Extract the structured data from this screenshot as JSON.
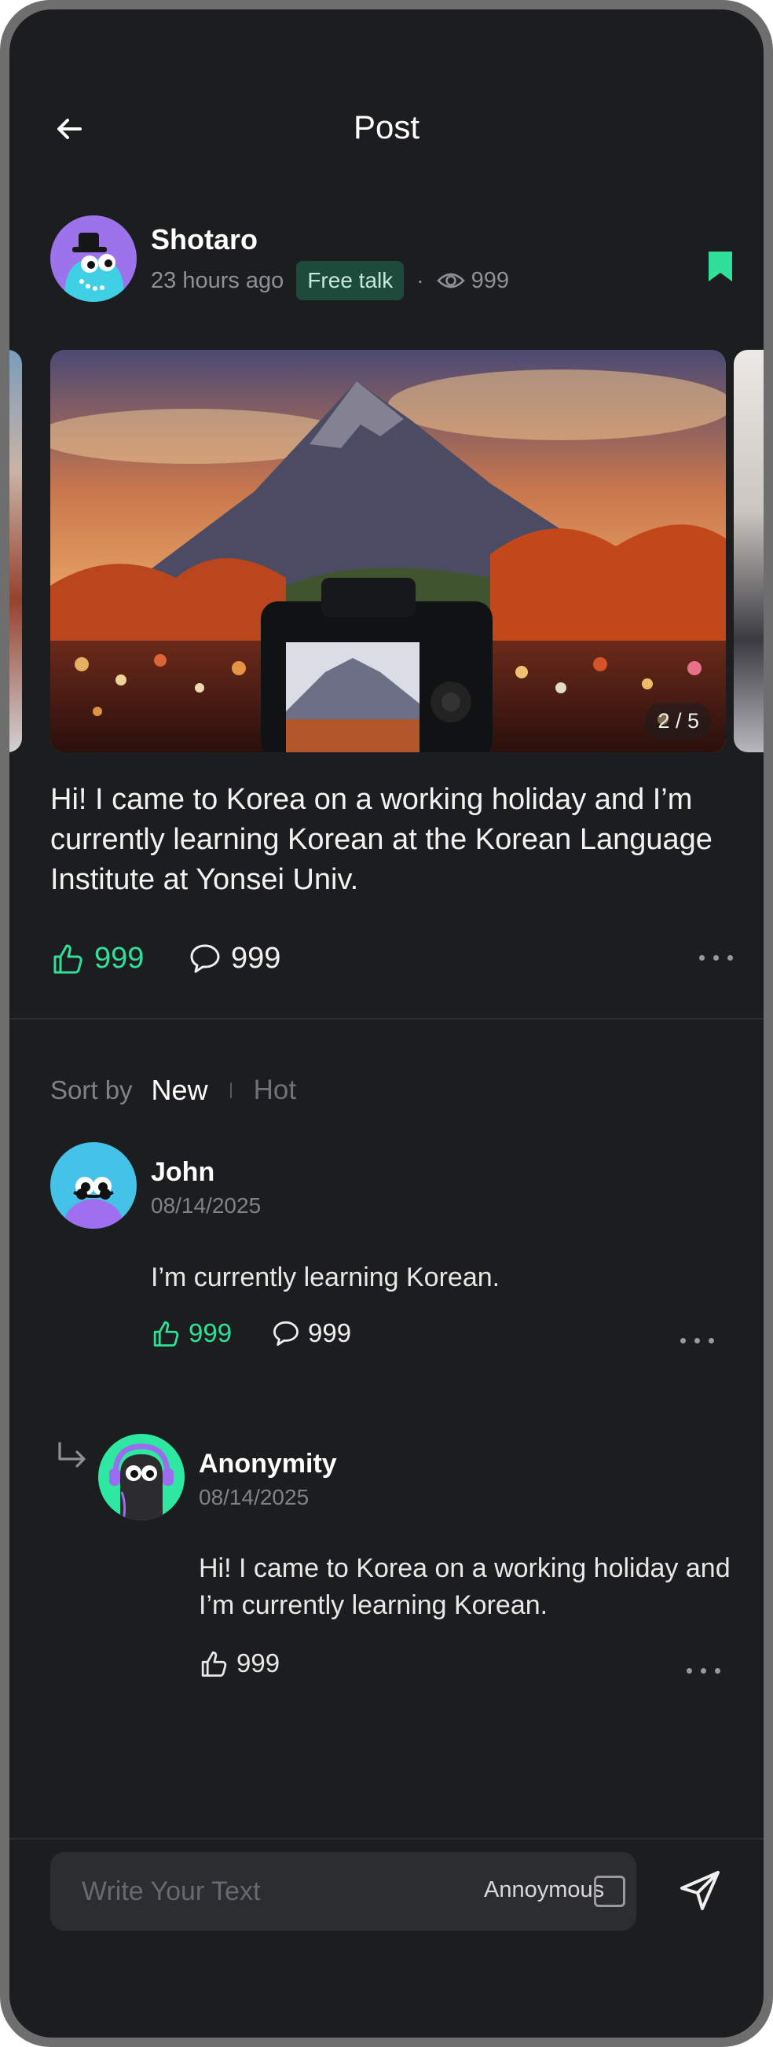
{
  "header": {
    "title": "Post"
  },
  "post": {
    "author": "Shotaro",
    "time": "23 hours ago",
    "category": "Free talk",
    "dot": "·",
    "views": "999",
    "slide_counter": "2 / 5",
    "text": "Hi! I came to Korea on a working holiday and I’m currently learning Korean at the Korean Language Institute at Yonsei Univ.",
    "likes": "999",
    "comments": "999"
  },
  "sort": {
    "label": "Sort by",
    "new": "New",
    "hot": "Hot"
  },
  "comments": [
    {
      "author": "John",
      "date": "08/14/2025",
      "text": "I’m currently learning Korean.",
      "likes": "999",
      "replies": "999"
    }
  ],
  "reply": {
    "author": "Anonymity",
    "date": "08/14/2025",
    "text": "Hi! I came to Korea on a working holiday and I’m currently learning Korean.",
    "likes": "999"
  },
  "composer": {
    "placeholder": "Write Your Text",
    "anonymous_label": "Annoymous",
    "anonymous_checked": false
  },
  "colors": {
    "accent": "#30e09a",
    "background": "#1c1d1f",
    "tag_bg": "#1d4a3a"
  },
  "icons": [
    "back-arrow-icon",
    "bookmark-icon",
    "eye-icon",
    "thumbs-up-icon",
    "comment-bubble-icon",
    "more-icon",
    "reply-arrow-icon",
    "send-icon"
  ]
}
